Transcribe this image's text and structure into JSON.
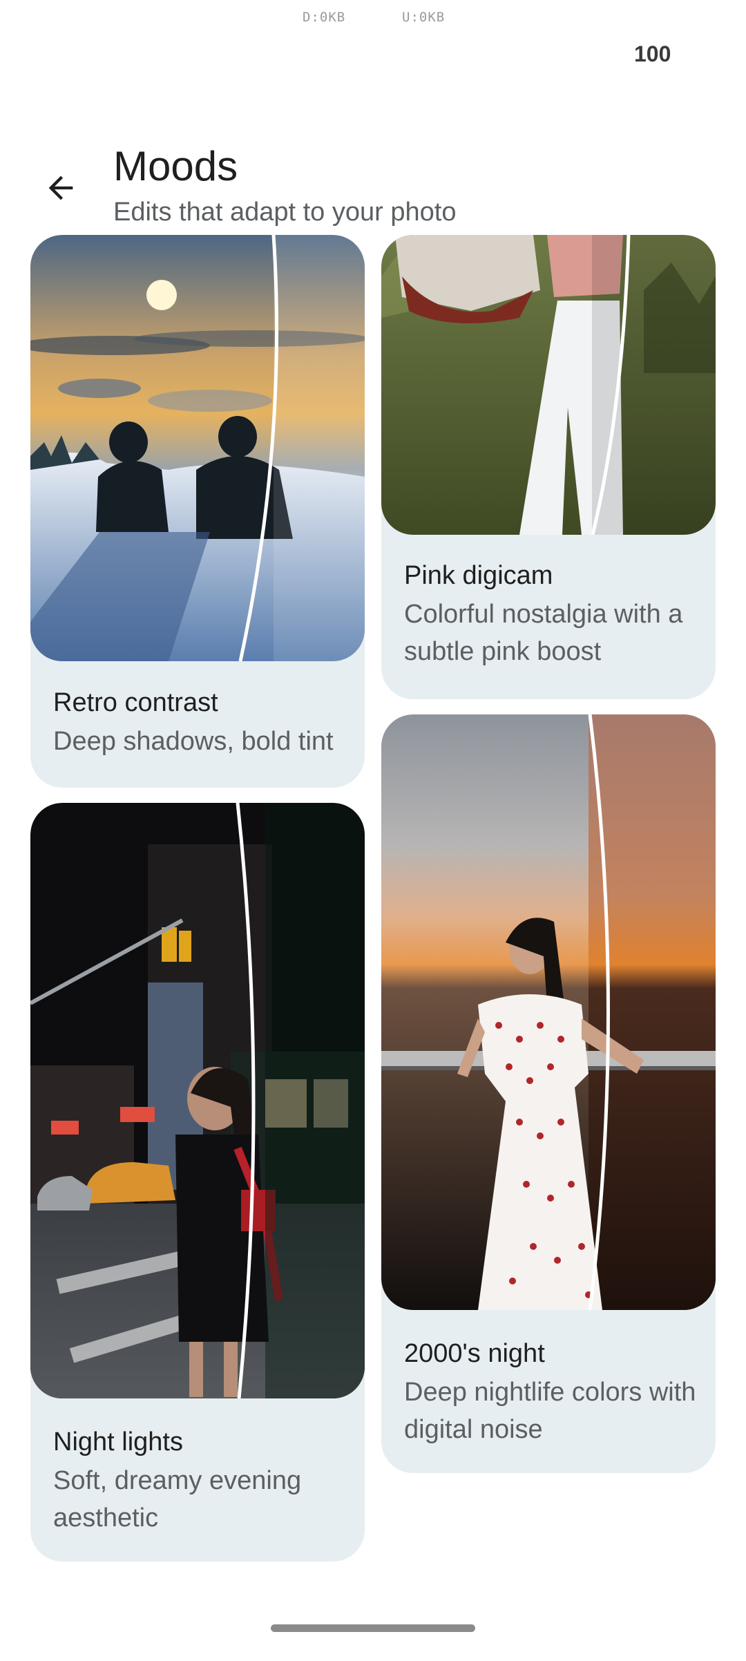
{
  "status_bar": {
    "download": "D:0KB",
    "upload": "U:0KB",
    "battery": "100"
  },
  "header": {
    "back_icon": "arrow-back-icon",
    "title": "Moods",
    "subtitle": "Edits that adapt to your photo"
  },
  "moods": [
    {
      "title": "Retro contrast",
      "description": "Deep shadows, bold tint"
    },
    {
      "title": "Pink digicam",
      "description": "Colorful nostalgia with a subtle pink boost"
    },
    {
      "title": "Night lights",
      "description": "Soft, dreamy evening aesthetic"
    },
    {
      "title": "2000's night",
      "description": "Deep nightlife colors with digital noise"
    }
  ],
  "colors": {
    "card_background": "#e6eef1",
    "title_text": "#1f1f1f",
    "secondary_text": "#5b5f62"
  }
}
